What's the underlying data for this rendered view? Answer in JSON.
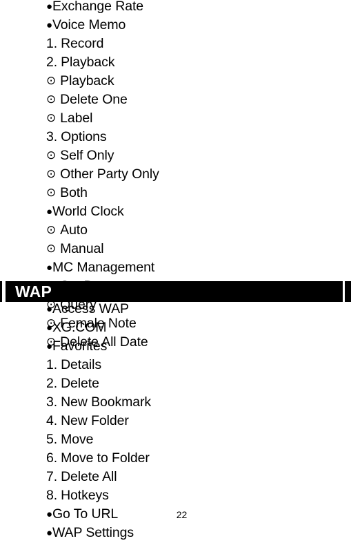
{
  "page": {
    "number": "22",
    "markers": {
      "bullet": "●",
      "radio": "⊙"
    }
  },
  "sections": [
    {
      "id": "section-top",
      "has_header_bar": false,
      "header": "",
      "items": [
        {
          "type": "bullet",
          "marker": "●",
          "label": "Exchange Rate"
        },
        {
          "type": "bullet",
          "marker": "●",
          "label": "Voice Memo"
        },
        {
          "type": "number",
          "marker": "1.",
          "label": "Record"
        },
        {
          "type": "number",
          "marker": "2.",
          "label": "Playback"
        },
        {
          "type": "radio",
          "marker": "⊙",
          "label": "Playback"
        },
        {
          "type": "radio",
          "marker": "⊙",
          "label": "Delete One"
        },
        {
          "type": "radio",
          "marker": "⊙",
          "label": "Label"
        },
        {
          "type": "number",
          "marker": "3.",
          "label": "Options"
        },
        {
          "type": "radio",
          "marker": "⊙",
          "label": "Self Only"
        },
        {
          "type": "radio",
          "marker": "⊙",
          "label": "Other Party Only"
        },
        {
          "type": "radio",
          "marker": "⊙",
          "label": "Both"
        },
        {
          "type": "bullet",
          "marker": "●",
          "label": "World Clock"
        },
        {
          "type": "radio",
          "marker": "⊙",
          "label": "Auto"
        },
        {
          "type": "radio",
          "marker": "⊙",
          "label": "Manual"
        },
        {
          "type": "bullet",
          "marker": "●",
          "label": "MC Management"
        },
        {
          "type": "radio",
          "marker": "⊙",
          "label": "Set Date"
        },
        {
          "type": "radio",
          "marker": "⊙",
          "label": "Query"
        },
        {
          "type": "radio",
          "marker": "⊙",
          "label": "Female Note"
        },
        {
          "type": "radio",
          "marker": "⊙",
          "label": "Delete All Date"
        }
      ]
    },
    {
      "id": "section-wap",
      "has_header_bar": true,
      "header": "WAP",
      "items": [
        {
          "type": "bullet",
          "marker": "●",
          "label": "Access WAP"
        },
        {
          "type": "bullet",
          "marker": "●",
          "label": "XG.COM"
        },
        {
          "type": "bullet",
          "marker": "●",
          "label": "Favorites"
        },
        {
          "type": "number",
          "marker": "1.",
          "label": "Details"
        },
        {
          "type": "number",
          "marker": "2.",
          "label": "Delete"
        },
        {
          "type": "number",
          "marker": "3.",
          "label": "New Bookmark"
        },
        {
          "type": "number",
          "marker": "4.",
          "label": "New Folder"
        },
        {
          "type": "number",
          "marker": "5.",
          "label": "Move"
        },
        {
          "type": "number",
          "marker": "6.",
          "label": "Move to Folder"
        },
        {
          "type": "number",
          "marker": "7.",
          "label": "Delete All"
        },
        {
          "type": "number",
          "marker": "8.",
          "label": "Hotkeys"
        },
        {
          "type": "bullet",
          "marker": "●",
          "label": "Go To URL"
        },
        {
          "type": "bullet",
          "marker": "●",
          "label": "WAP Settings"
        }
      ]
    }
  ],
  "colors": {
    "page_background": "#ffffff",
    "text": "#000000",
    "header_bar_background": "#000000",
    "header_bar_text": "#ffffff"
  }
}
